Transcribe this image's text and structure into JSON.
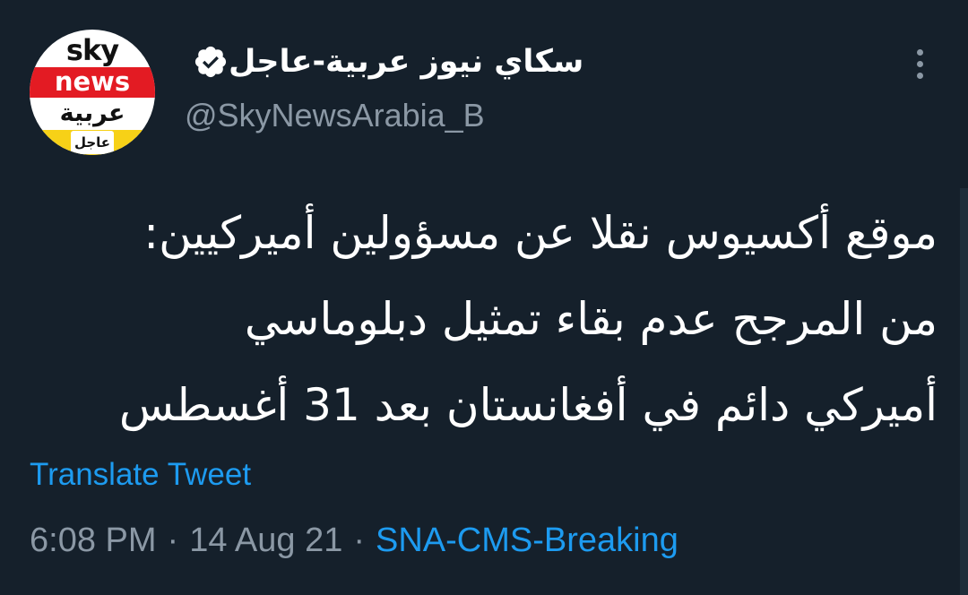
{
  "account": {
    "display_name": "سكاي نيوز عربية-عاجل",
    "handle": "@SkyNewsArabia_B",
    "verified": true,
    "avatar": {
      "word_sky": "sky",
      "word_news": "news",
      "word_arabic": "عربية",
      "word_urgent": "عاجل",
      "brand_red": "#e31b23",
      "brand_yellow": "#f7d117"
    }
  },
  "tweet": {
    "text": "موقع أكسيوس نقلا عن مسؤولين أميركيين:\nمن المرجح عدم بقاء تمثيل دبلوماسي\nأميركي دائم في أفغانستان بعد 31 أغسطس",
    "translate_label": "Translate Tweet",
    "time": "6:08 PM",
    "separator": "·",
    "date": "14 Aug 21",
    "source": "SNA-CMS-Breaking"
  },
  "icons": {
    "verified": "verified-badge-icon",
    "more": "more-options-icon"
  },
  "colors": {
    "background": "#15202b",
    "text": "#ffffff",
    "secondary": "#8b98a5",
    "link": "#1d9bf0"
  }
}
